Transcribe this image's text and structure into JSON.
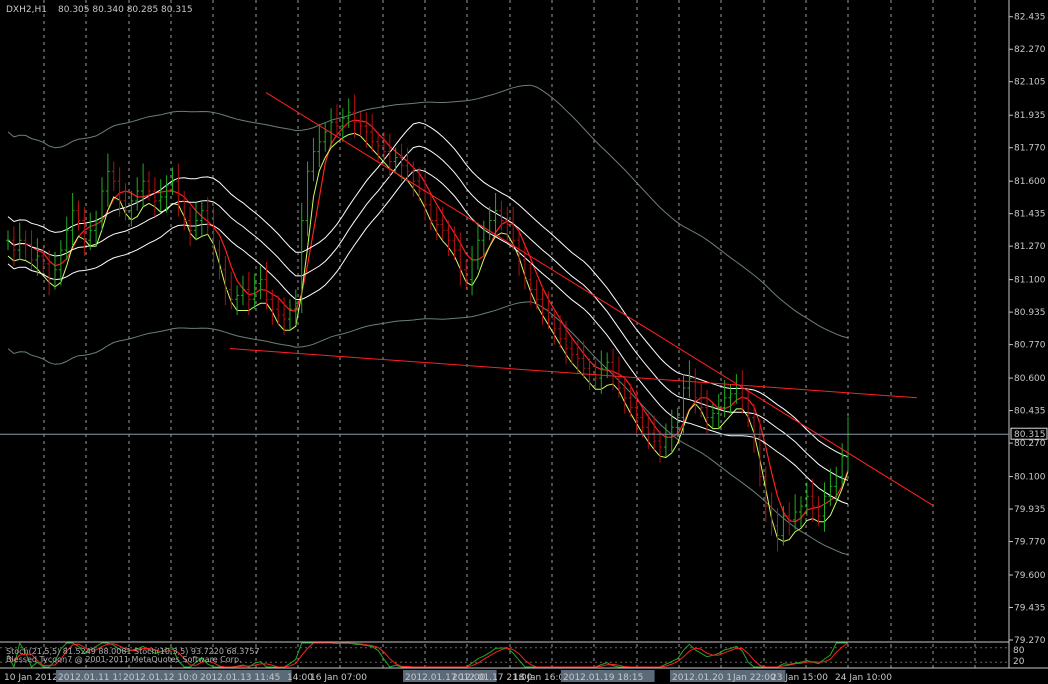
{
  "header": {
    "symbol": "DXH2,H1",
    "ohlc": "80.305 80.340 80.285 80.315"
  },
  "indicator": {
    "line1": "Stoch(21,5,5) 81.5249 88.0081 Stoch(10,3,5) 93.7220 68.3757",
    "line2": "Blessed Tycoon7 @ 2001-2011 MetaQuotes Software Corp."
  },
  "colors": {
    "background": "#000000",
    "grid": "#9a9a9a",
    "axis_text": "#c8c8c8",
    "bar_up": "#22aa22",
    "bar_down": "#b01010",
    "ma_red": "#ff2020",
    "ma_lime": "#ccff66",
    "ma_white": "#ffffff",
    "bands": "#6a7f7a",
    "trendline": "#ff2020"
  },
  "chart_data": {
    "type": "candlestick",
    "title": "DXH2,H1",
    "timeframe": "H1",
    "ylim": [
      79.27,
      82.52
    ],
    "y_ticks": [
      "82.435",
      "82.270",
      "82.105",
      "81.935",
      "81.770",
      "81.600",
      "81.435",
      "81.270",
      "81.100",
      "80.935",
      "80.770",
      "80.600",
      "80.435",
      "80.270",
      "80.100",
      "79.935",
      "79.770",
      "79.600",
      "79.435",
      "79.270"
    ],
    "current_price": "80.315",
    "x_ticks": [
      "10 Jan 2012",
      "2012.01.11 11:30",
      "2012.01.12 10:00",
      "2012.01.13 11:45",
      "14:00",
      "16 Jan 07:00",
      "2012.01.17 12:00",
      "2012.01.17 21:00",
      "18 Jan 16:00",
      "2012.01.19 18:15",
      "2012.01.20 16:00",
      "Jan 22:00",
      "23 Jan 15:00",
      "24 Jan 10:00"
    ],
    "indicator_ticks": [
      "80",
      "20"
    ],
    "close": [
      81.3,
      81.25,
      81.3,
      81.28,
      81.2,
      81.22,
      81.18,
      81.1,
      81.15,
      81.25,
      81.35,
      81.45,
      81.4,
      81.3,
      81.35,
      81.4,
      81.55,
      81.65,
      81.6,
      81.5,
      81.45,
      81.5,
      81.55,
      81.6,
      81.55,
      81.5,
      81.52,
      81.58,
      81.6,
      81.5,
      81.4,
      81.35,
      81.4,
      81.45,
      81.38,
      81.25,
      81.15,
      81.05,
      81.0,
      81.02,
      81.05,
      81.0,
      81.08,
      81.1,
      81.0,
      80.95,
      80.92,
      80.9,
      80.95,
      80.98,
      81.4,
      81.65,
      81.75,
      81.8,
      81.85,
      81.9,
      81.88,
      81.92,
      81.95,
      81.9,
      81.88,
      81.85,
      81.8,
      81.78,
      81.75,
      81.7,
      81.72,
      81.68,
      81.65,
      81.6,
      81.55,
      81.48,
      81.4,
      81.38,
      81.35,
      81.3,
      81.25,
      81.15,
      81.1,
      81.2,
      81.3,
      81.35,
      81.4,
      81.45,
      81.4,
      81.38,
      81.3,
      81.2,
      81.1,
      81.05,
      81.0,
      80.95,
      80.9,
      80.85,
      80.8,
      80.75,
      80.72,
      80.7,
      80.65,
      80.62,
      80.6,
      80.65,
      80.68,
      80.62,
      80.55,
      80.5,
      80.45,
      80.4,
      80.35,
      80.32,
      80.28,
      80.25,
      80.3,
      80.35,
      80.4,
      80.55,
      80.6,
      80.5,
      80.45,
      80.4,
      80.42,
      80.45,
      80.5,
      80.52,
      80.55,
      80.5,
      80.4,
      80.3,
      80.1,
      79.95,
      79.85,
      79.8,
      79.9,
      79.88,
      79.92,
      79.95,
      80.0,
      79.95,
      79.9,
      80.0,
      80.05,
      80.1,
      80.2,
      80.315
    ],
    "series": [
      {
        "name": "",
        "kind": "ma",
        "color": "#ff2020"
      },
      {
        "name": "",
        "kind": "ma",
        "color": "#ccff66"
      },
      {
        "name": "",
        "kind": "ma",
        "color": "#ffffff"
      },
      {
        "name": "",
        "kind": "band",
        "color": "#6a7f7a"
      }
    ],
    "trendlines": [
      {
        "from": [
          "bar",
          0,
          82.05
        ],
        "to": [
          "bar",
          1,
          79.95
        ]
      },
      {
        "from": [
          "bar",
          0,
          80.75
        ],
        "to": [
          "bar",
          1,
          80.5
        ]
      }
    ],
    "grid": true
  }
}
